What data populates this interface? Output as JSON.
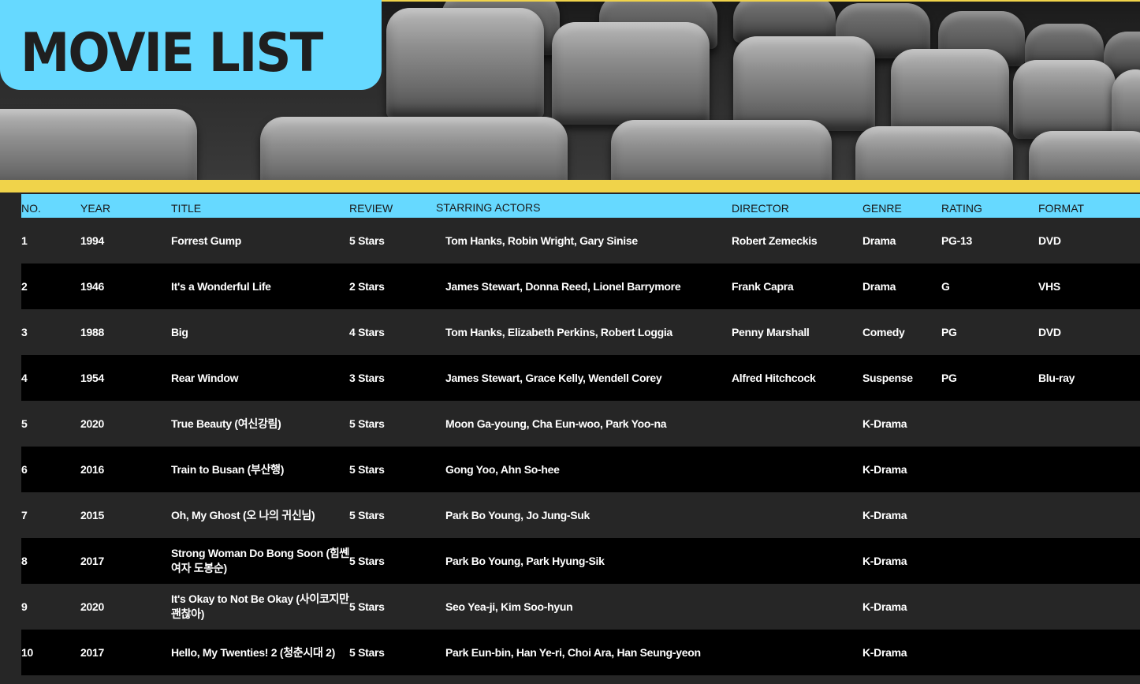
{
  "header": {
    "title": "MOVIE LIST"
  },
  "colors": {
    "accent": "#66d9ff",
    "stripe": "#f0d34a",
    "row_dark": "#000000",
    "row_mid": "#262626",
    "text": "#ffffff"
  },
  "table": {
    "columns": {
      "no": "NO.",
      "year": "YEAR",
      "title": "TITLE",
      "review": "REVIEW",
      "actors": "STARRING ACTORS",
      "director": "DIRECTOR",
      "genre": "GENRE",
      "rating": "RATING",
      "format": "FORMAT"
    },
    "rows": [
      {
        "no": "1",
        "year": "1994",
        "title": "Forrest Gump",
        "review": "5 Stars",
        "actors": "Tom Hanks, Robin Wright, Gary Sinise",
        "director": "Robert Zemeckis",
        "genre": "Drama",
        "rating": "PG-13",
        "format": "DVD"
      },
      {
        "no": "2",
        "year": "1946",
        "title": "It's a Wonderful Life",
        "review": "2 Stars",
        "actors": "James Stewart, Donna Reed, Lionel Barrymore",
        "director": "Frank Capra",
        "genre": "Drama",
        "rating": "G",
        "format": "VHS"
      },
      {
        "no": "3",
        "year": "1988",
        "title": "Big",
        "review": "4 Stars",
        "actors": "Tom Hanks, Elizabeth Perkins, Robert Loggia",
        "director": "Penny Marshall",
        "genre": "Comedy",
        "rating": "PG",
        "format": "DVD"
      },
      {
        "no": "4",
        "year": "1954",
        "title": "Rear Window",
        "review": "3 Stars",
        "actors": "James Stewart, Grace Kelly, Wendell Corey",
        "director": "Alfred Hitchcock",
        "genre": "Suspense",
        "rating": "PG",
        "format": "Blu-ray"
      },
      {
        "no": "5",
        "year": "2020",
        "title": "True Beauty (여신강림)",
        "review": "5 Stars",
        "actors": "Moon Ga-young, Cha Eun-woo, Park Yoo-na",
        "director": "",
        "genre": "K-Drama",
        "rating": "",
        "format": ""
      },
      {
        "no": "6",
        "year": "2016",
        "title": "Train to Busan (부산행)",
        "review": "5 Stars",
        "actors": "Gong Yoo, Ahn So-hee",
        "director": "",
        "genre": "K-Drama",
        "rating": "",
        "format": ""
      },
      {
        "no": "7",
        "year": "2015",
        "title": "Oh, My Ghost (오 나의 귀신님)",
        "review": "5 Stars",
        "actors": "Park Bo Young, Jo Jung-Suk",
        "director": "",
        "genre": "K-Drama",
        "rating": "",
        "format": ""
      },
      {
        "no": "8",
        "year": "2017",
        "title": "Strong Woman Do Bong Soon (힘쎈 여자 도봉순)",
        "review": "5 Stars",
        "actors": "Park Bo Young, Park Hyung-Sik",
        "director": "",
        "genre": "K-Drama",
        "rating": "",
        "format": ""
      },
      {
        "no": "9",
        "year": "2020",
        "title": "It's Okay to Not Be Okay (사이코지만 괜찮아)",
        "review": "5 Stars",
        "actors": "Seo Yea-ji, Kim Soo-hyun",
        "director": "",
        "genre": "K-Drama",
        "rating": "",
        "format": ""
      },
      {
        "no": "10",
        "year": "2017",
        "title": "Hello, My Twenties! 2 (청춘시대 2)",
        "review": "5 Stars",
        "actors": "Park Eun-bin, Han Ye-ri, Choi Ara, Han Seung-yeon",
        "director": "",
        "genre": "K-Drama",
        "rating": "",
        "format": ""
      }
    ]
  }
}
